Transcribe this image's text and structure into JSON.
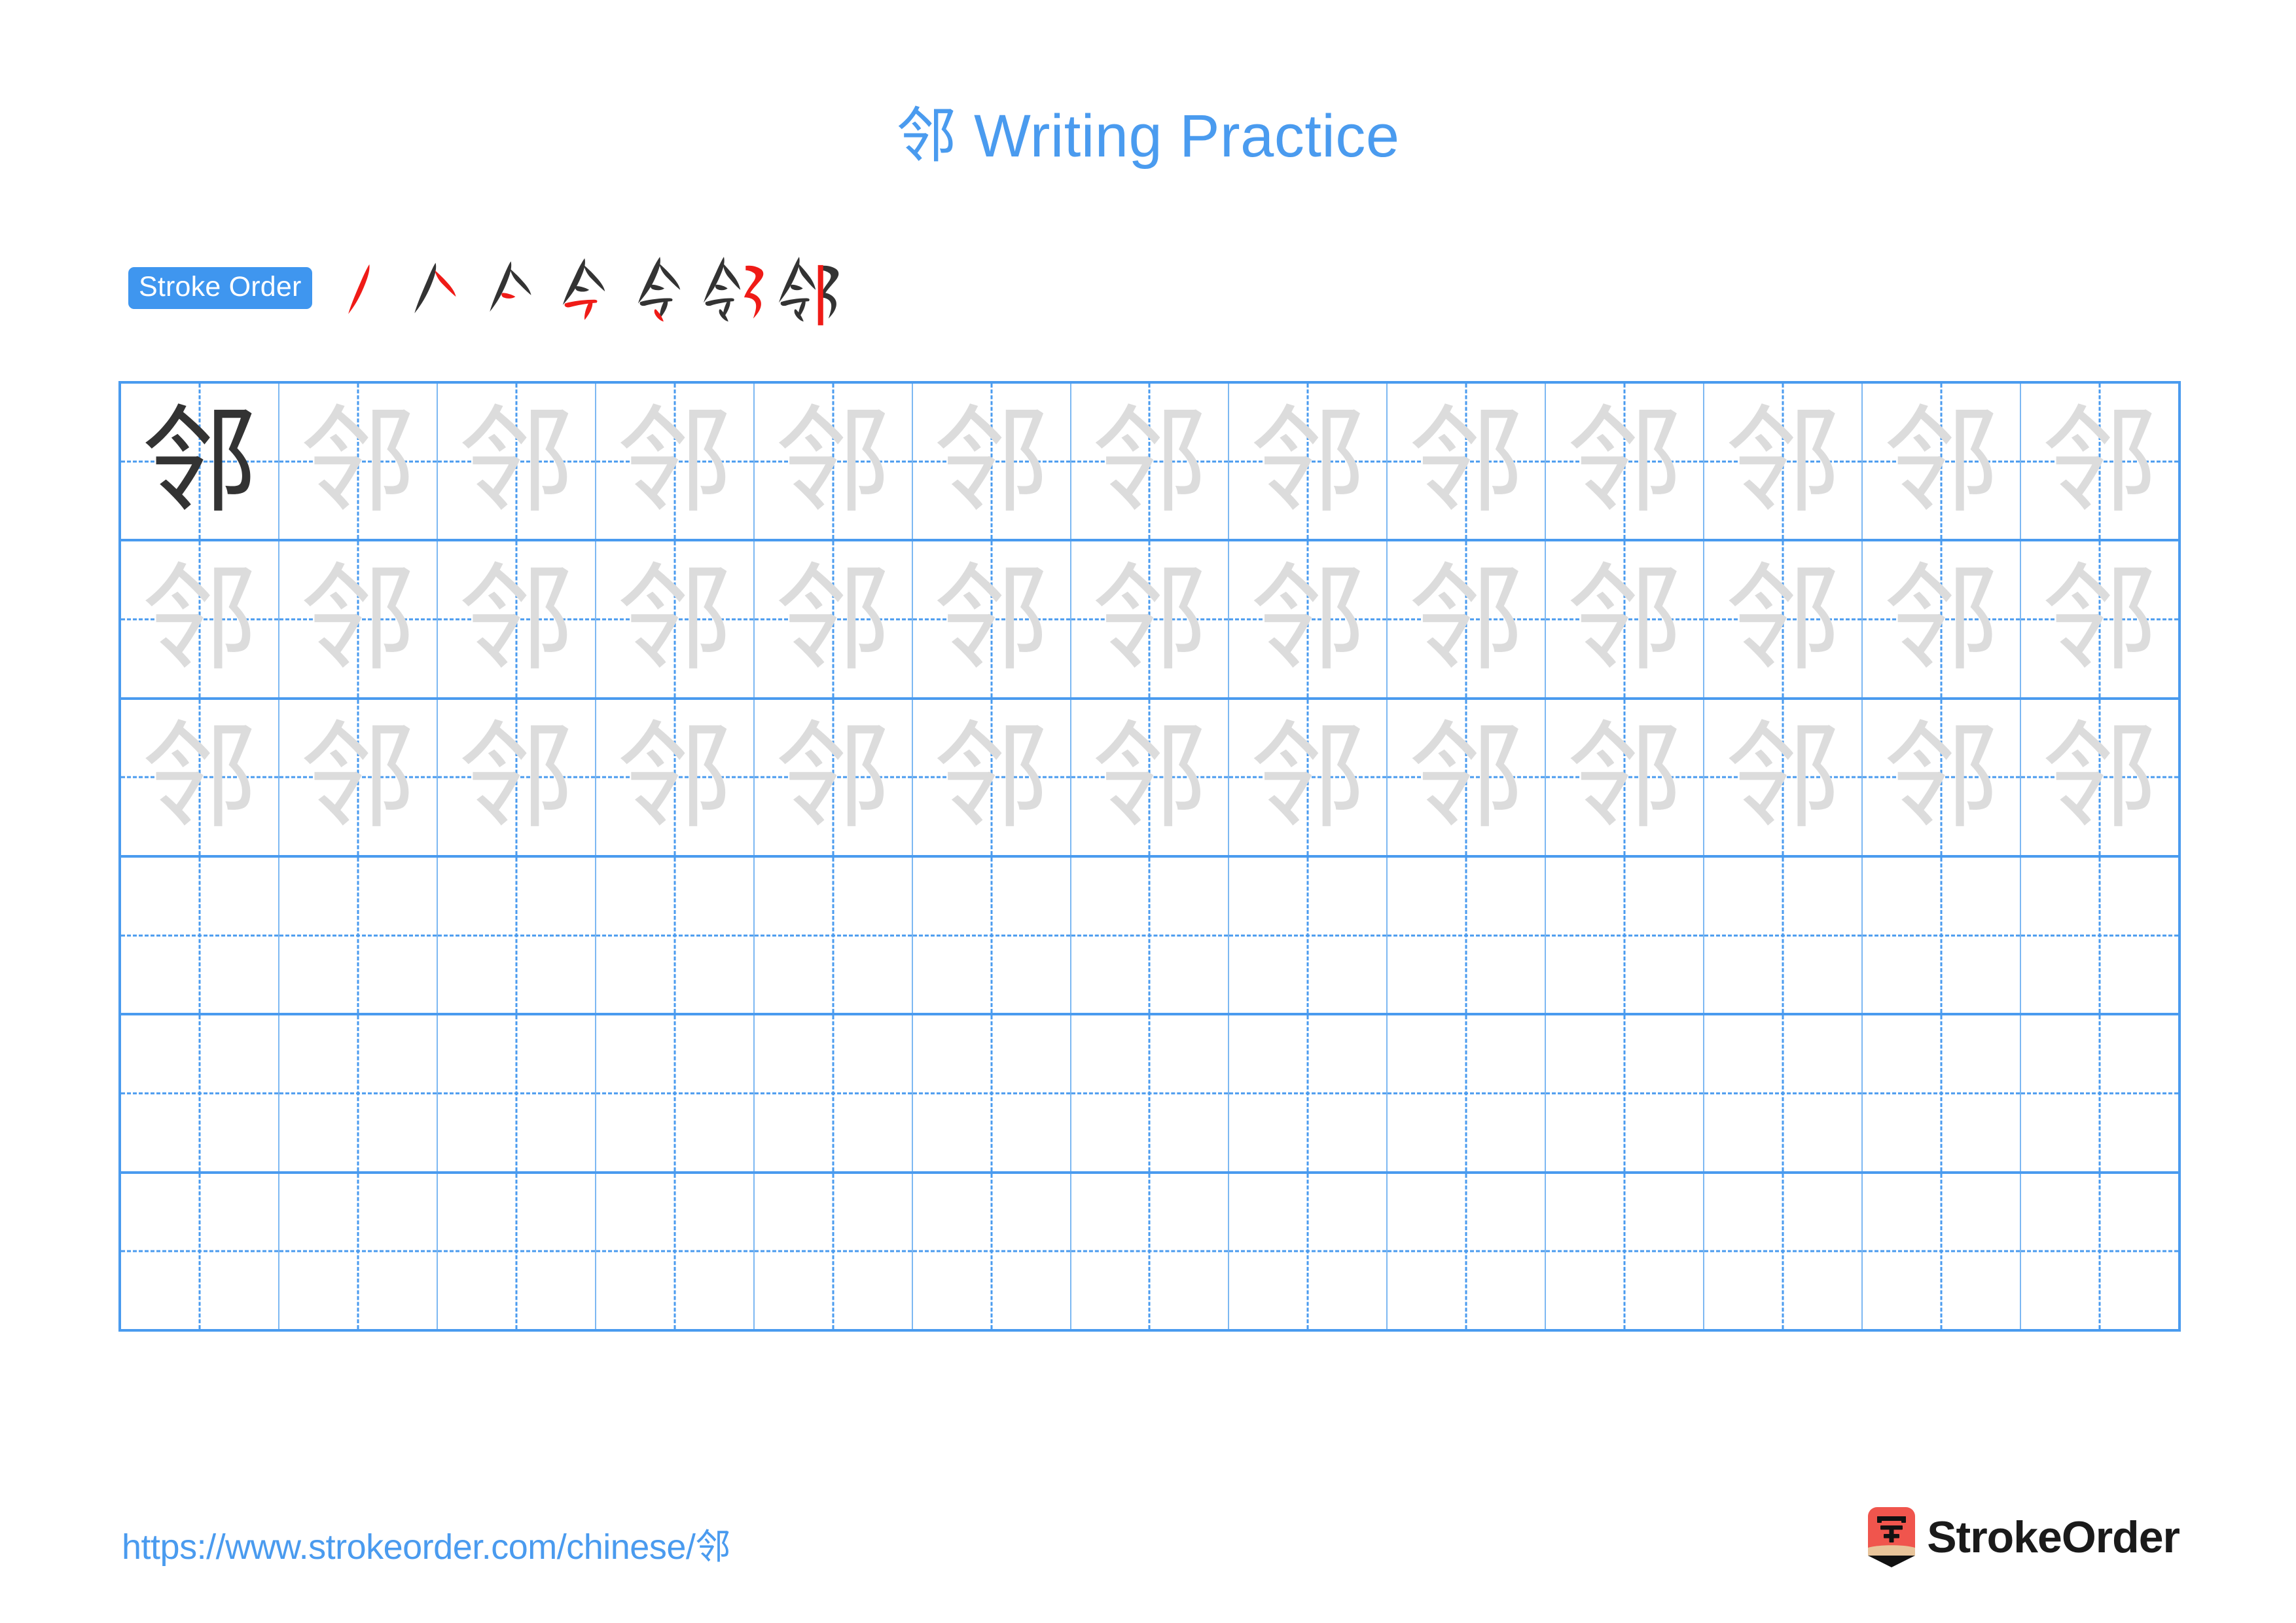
{
  "character": "邻",
  "title": "邻 Writing Practice",
  "colors": {
    "accent_blue": "#4a9bef",
    "badge_blue": "#3f96ef",
    "grid_line": "#4a9bef",
    "grid_line_light": "#7db8f2",
    "trace_gray": "#dcdcdc",
    "ink_dark": "#333333",
    "new_stroke_red": "#ef1b17",
    "logo_red": "#f0554d",
    "logo_tan": "#e8c49a",
    "logo_text": "#1a1a1a"
  },
  "stroke_order": {
    "badge_label": "Stroke Order",
    "total_strokes": 7,
    "steps": [
      {
        "index": 1,
        "name": "stroke-step-1",
        "strokes_shown": 1
      },
      {
        "index": 2,
        "name": "stroke-step-2",
        "strokes_shown": 2
      },
      {
        "index": 3,
        "name": "stroke-step-3",
        "strokes_shown": 3
      },
      {
        "index": 4,
        "name": "stroke-step-4",
        "strokes_shown": 4
      },
      {
        "index": 5,
        "name": "stroke-step-5",
        "strokes_shown": 5
      },
      {
        "index": 6,
        "name": "stroke-step-6",
        "strokes_shown": 6
      },
      {
        "index": 7,
        "name": "stroke-step-7",
        "strokes_shown": 7
      }
    ]
  },
  "grid": {
    "columns": 13,
    "rows": 6,
    "rows_data": [
      {
        "row": 1,
        "cells": [
          "dark",
          "trace",
          "trace",
          "trace",
          "trace",
          "trace",
          "trace",
          "trace",
          "trace",
          "trace",
          "trace",
          "trace",
          "trace"
        ]
      },
      {
        "row": 2,
        "cells": [
          "trace",
          "trace",
          "trace",
          "trace",
          "trace",
          "trace",
          "trace",
          "trace",
          "trace",
          "trace",
          "trace",
          "trace",
          "trace"
        ]
      },
      {
        "row": 3,
        "cells": [
          "trace",
          "trace",
          "trace",
          "trace",
          "trace",
          "trace",
          "trace",
          "trace",
          "trace",
          "trace",
          "trace",
          "trace",
          "trace"
        ]
      },
      {
        "row": 4,
        "cells": [
          "blank",
          "blank",
          "blank",
          "blank",
          "blank",
          "blank",
          "blank",
          "blank",
          "blank",
          "blank",
          "blank",
          "blank",
          "blank"
        ]
      },
      {
        "row": 5,
        "cells": [
          "blank",
          "blank",
          "blank",
          "blank",
          "blank",
          "blank",
          "blank",
          "blank",
          "blank",
          "blank",
          "blank",
          "blank",
          "blank"
        ]
      },
      {
        "row": 6,
        "cells": [
          "blank",
          "blank",
          "blank",
          "blank",
          "blank",
          "blank",
          "blank",
          "blank",
          "blank",
          "blank",
          "blank",
          "blank",
          "blank"
        ]
      }
    ]
  },
  "footer": {
    "url": "https://www.strokeorder.com/chinese/邻",
    "logo_text": "StrokeOrder",
    "logo_glyph": "字"
  }
}
